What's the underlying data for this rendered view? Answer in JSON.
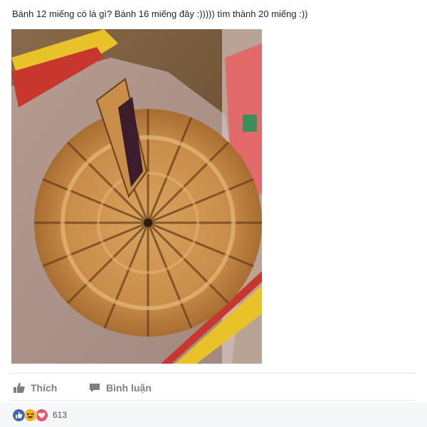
{
  "post": {
    "text": "Bánh 12 miếng có là gì? Bánh 16 miếng đây :))))) tìm thành 20 miếng :))"
  },
  "actions": {
    "like_label": "Thích",
    "comment_label": "Bình luận"
  },
  "reactions": {
    "icons": [
      "like-icon",
      "haha-icon",
      "love-icon"
    ],
    "count": "613"
  },
  "colors": {
    "like_blue": "#4267b2",
    "haha_yellow": "#f7b125",
    "love_red": "#f25268",
    "action_gray": "#7f7f7f"
  }
}
